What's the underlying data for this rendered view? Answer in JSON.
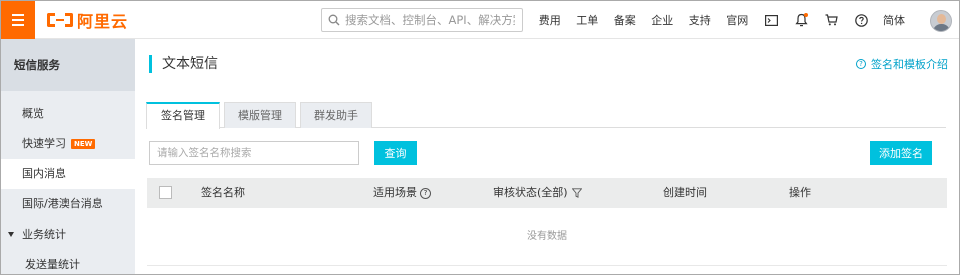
{
  "topbar": {
    "logo_text": "阿里云",
    "search_placeholder": "搜索文档、控制台、API、解决方案",
    "nav_links": [
      "费用",
      "工单",
      "备案",
      "企业",
      "支持",
      "官网"
    ],
    "icons": [
      "terminal-icon",
      "bell-icon",
      "cart-icon",
      "help-icon"
    ],
    "lang": "简体"
  },
  "sidebar": {
    "title": "短信服务",
    "items": [
      {
        "label": "概览"
      },
      {
        "label": "快速学习",
        "badge": "NEW"
      },
      {
        "label": "国内消息",
        "active": true
      },
      {
        "label": "国际/港澳台消息"
      }
    ],
    "group": {
      "label": "业务统计",
      "children": [
        {
          "label": "发送量统计"
        }
      ]
    }
  },
  "main": {
    "title": "文本短信",
    "help_link": "签名和模板介绍",
    "tabs": [
      {
        "label": "签名管理",
        "active": true
      },
      {
        "label": "模版管理"
      },
      {
        "label": "群发助手"
      }
    ],
    "search_placeholder": "请输入签名名称搜索",
    "query_button": "查询",
    "add_button": "添加签名",
    "columns": [
      "签名名称",
      "适用场景",
      "审核状态(全部)",
      "创建时间",
      "操作"
    ],
    "empty_text": "没有数据"
  },
  "colors": {
    "brand": "#ff6a00",
    "accent": "#00c1de",
    "link": "#00a2ca"
  }
}
